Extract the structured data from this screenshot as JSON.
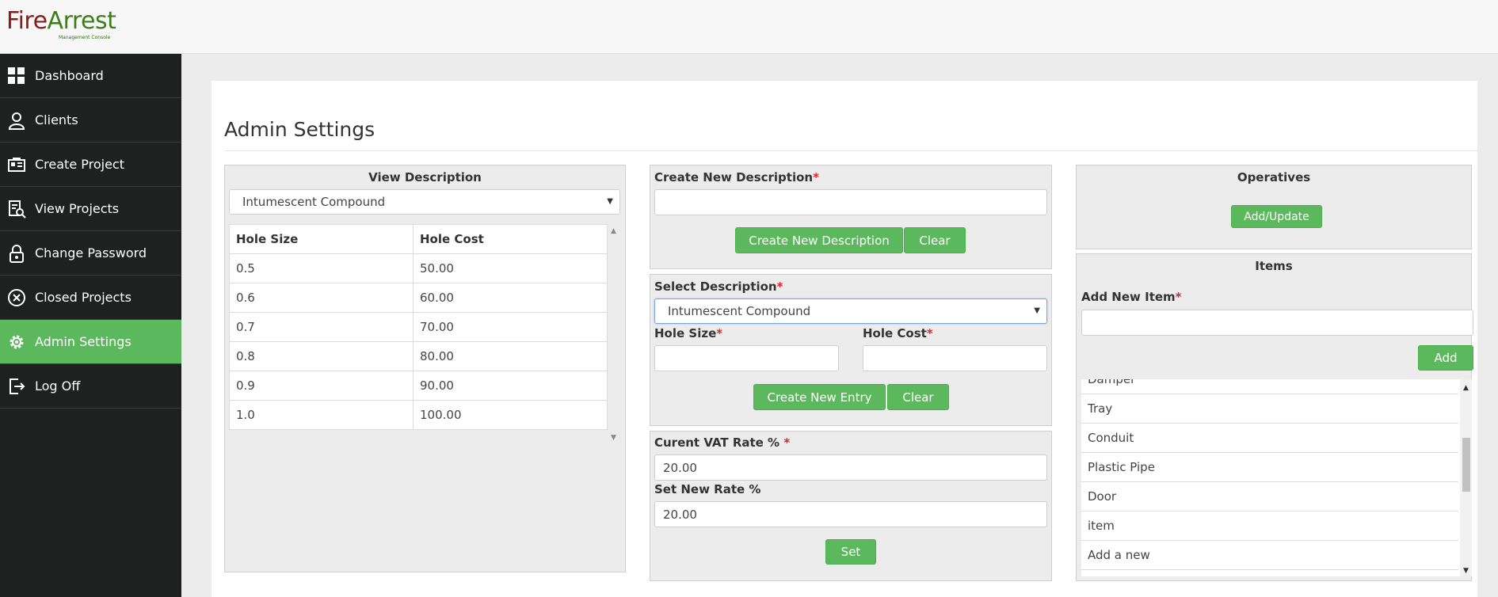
{
  "brand": {
    "fire": "Fire",
    "arrest": "Arrest",
    "tagline": "Management Console"
  },
  "sidebar": {
    "items": [
      {
        "label": "Dashboard",
        "icon": "dashboard-icon"
      },
      {
        "label": "Clients",
        "icon": "client-icon"
      },
      {
        "label": "Create Project",
        "icon": "create-project-icon"
      },
      {
        "label": "View Projects",
        "icon": "view-projects-icon"
      },
      {
        "label": "Change Password",
        "icon": "lock-icon"
      },
      {
        "label": "Closed Projects",
        "icon": "close-circle-icon"
      },
      {
        "label": "Admin Settings",
        "icon": "gear-icon",
        "active": true
      },
      {
        "label": "Log Off",
        "icon": "logoff-icon"
      }
    ]
  },
  "page": {
    "title": "Admin Settings"
  },
  "view_description": {
    "heading": "View Description",
    "selected": "Intumescent Compound",
    "columns": [
      "Hole Size",
      "Hole Cost"
    ],
    "rows": [
      [
        "0.5",
        "50.00"
      ],
      [
        "0.6",
        "60.00"
      ],
      [
        "0.7",
        "70.00"
      ],
      [
        "0.8",
        "80.00"
      ],
      [
        "0.9",
        "90.00"
      ],
      [
        "1.0",
        "100.00"
      ]
    ]
  },
  "create_description": {
    "label": "Create New Description",
    "required": "*",
    "value": "",
    "create_button": "Create New Description",
    "clear_button": "Clear"
  },
  "select_description": {
    "label": "Select Description",
    "required": "*",
    "selected": "Intumescent Compound",
    "hole_size_label": "Hole Size",
    "hole_cost_label": "Hole Cost",
    "hole_size_value": "",
    "hole_cost_value": "",
    "create_button": "Create New Entry",
    "clear_button": "Clear"
  },
  "vat": {
    "current_label": "Curent VAT Rate %",
    "required": "*",
    "current_value": "20.00",
    "new_label": "Set New Rate %",
    "new_value": "20.00",
    "set_button": "Set"
  },
  "operatives": {
    "heading": "Operatives",
    "button": "Add/Update"
  },
  "items": {
    "heading": "Items",
    "add_label": "Add New Item",
    "required": "*",
    "add_value": "",
    "add_button": "Add",
    "list": [
      "Damper",
      "Tray",
      "Conduit",
      "Plastic Pipe",
      "Door",
      "item",
      "Add a new"
    ]
  },
  "colors": {
    "accent": "#5cb85c",
    "sidebar_bg": "#1e211f",
    "required": "#d9262c",
    "brand_red": "#8b1a1a",
    "brand_green": "#3f7d1b"
  }
}
